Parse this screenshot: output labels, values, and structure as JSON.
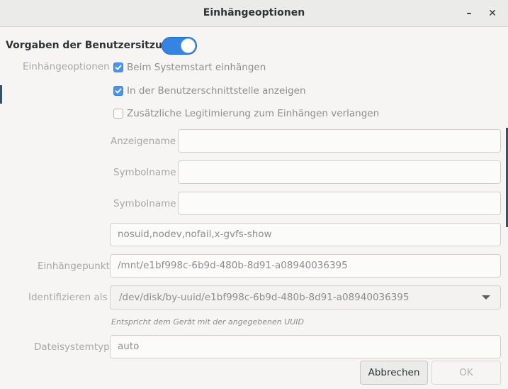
{
  "window": {
    "title": "Einhängeoptionen",
    "minimize_glyph": "–",
    "close_glyph": "✕"
  },
  "user_defaults": {
    "label": "Vorgaben der Benutzersitzung",
    "switch_on": true
  },
  "mount_options": {
    "section_label": "Einhängeoptionen",
    "checkboxes": [
      {
        "label": "Beim Systemstart einhängen",
        "checked": true
      },
      {
        "label": "In der Benutzerschnittstelle anzeigen",
        "checked": true
      },
      {
        "label": "Zusätzliche Legitimierung zum Einhängen verlangen",
        "checked": false
      }
    ],
    "display_name": {
      "label": "Anzeigename",
      "value": ""
    },
    "icon_name": {
      "label": "Symbolname",
      "value": ""
    },
    "symbolic_icon_name": {
      "label": "Symbolname",
      "value": ""
    },
    "options_value": "nosuid,nodev,nofail,x-gvfs-show"
  },
  "mount_point": {
    "label": "Einhängepunkt",
    "value": "/mnt/e1bf998c-6b9d-480b-8d91-a08940036395"
  },
  "identify_as": {
    "label": "Identifizieren als",
    "selected": "/dev/disk/by-uuid/e1bf998c-6b9d-480b-8d91-a08940036395",
    "hint": "Entspricht dem Gerät mit der angegebenen UUID"
  },
  "filesystem_type": {
    "label": "Dateisystemtyp",
    "value": "auto"
  },
  "buttons": {
    "cancel": "Abbrechen",
    "ok": "OK"
  },
  "colors": {
    "accent": "#3584e4",
    "checkbox_checked": "#4e93e6",
    "disabled_text": "#a6a8a6",
    "window_bg": "#f6f5f4"
  }
}
